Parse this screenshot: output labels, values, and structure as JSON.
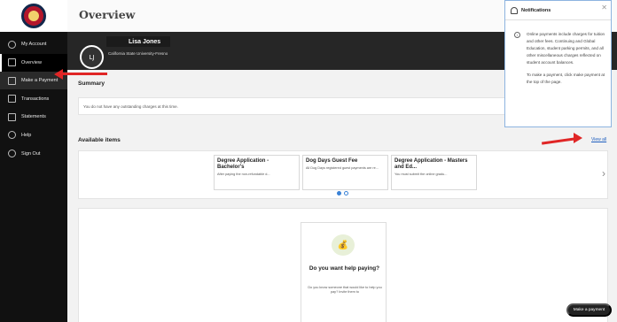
{
  "sidebar": {
    "items": [
      {
        "label": "My Account"
      },
      {
        "label": "Overview"
      },
      {
        "label": "Make a Payment"
      },
      {
        "label": "Transactions"
      },
      {
        "label": "Statements"
      },
      {
        "label": "Help"
      },
      {
        "label": "Sign Out"
      }
    ]
  },
  "header": {
    "title": "Overview"
  },
  "profile": {
    "name": "Lisa Jones",
    "university": "California State University-Fresno",
    "initials": "LJ"
  },
  "summary": {
    "title": "Summary",
    "message": "You do not have any outstanding charges at this time."
  },
  "available": {
    "title": "Available items",
    "view_all": "View all",
    "items": [
      {
        "title": "Degree Application - Bachelor's",
        "desc": "After paying the non-refundable d..."
      },
      {
        "title": "Dog Days Guest Fee",
        "desc": "All Dog Days registered guest payments are re..."
      },
      {
        "title": "Degree Application - Masters and Ed...",
        "desc": "You must submit the online gradu..."
      }
    ]
  },
  "help": {
    "title": "Do you want help paying?",
    "text": "Do you know someone that would like to help you pay? Invite them to"
  },
  "notifications": {
    "title": "Notifications",
    "p1": "Online payments include charges for tuition and other fees. Continuing and Global Education, student parking permits, and all other miscellaneous charges reflected on student account balances.",
    "p2": "To make a payment, click make payment at the top of the page."
  },
  "footer": {
    "pay_button": "Make a payment"
  },
  "colors": {
    "sidebar_bg": "#111111",
    "accent": "#e02626",
    "link": "#1f5fbf"
  }
}
